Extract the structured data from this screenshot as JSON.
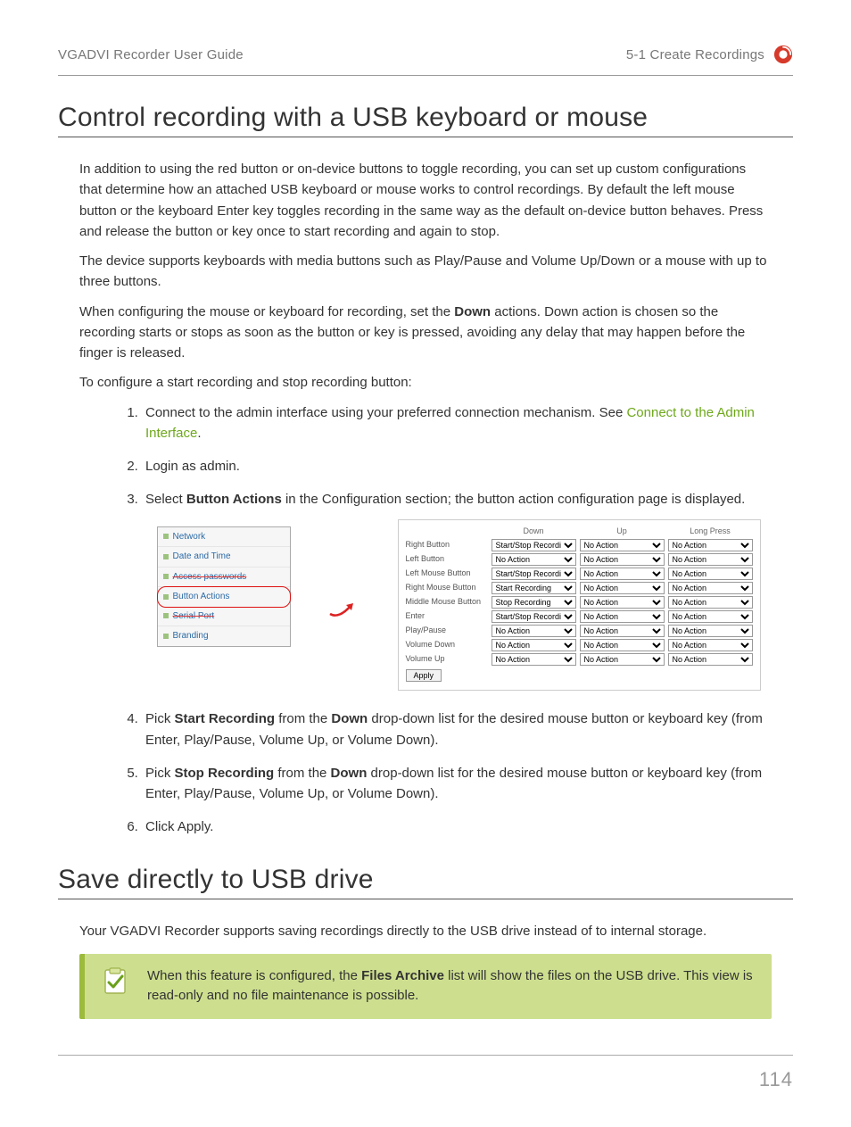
{
  "header": {
    "left": "VGADVI Recorder User Guide",
    "right": "5-1 Create Recordings"
  },
  "section1": {
    "title": "Control recording with a USB keyboard or mouse",
    "p1": "In addition to using the red button or on-device buttons to toggle recording, you can set up custom configurations that determine how an attached USB keyboard or mouse works to control recordings. By default the left mouse button or the keyboard Enter key toggles recording in the same way as the default on-device button behaves. Press and release the button or key once to start recording and again to stop.",
    "p2": "The device supports keyboards with media buttons such as Play/Pause and Volume Up/Down or a mouse with up to three buttons.",
    "p3a": "When configuring the mouse or keyboard for recording, set the ",
    "p3b": "Down",
    "p3c": " actions. Down action is chosen so the recording starts or stops as soon as the button or key is pressed, avoiding any delay that may happen before the finger is released.",
    "p4": "To configure a start recording and stop recording button:",
    "steps": {
      "s1a": "Connect to the admin interface using your preferred connection mechanism. See ",
      "s1link": "Connect to the Admin Interface",
      "s1b": ".",
      "s2": "Login as admin.",
      "s3a": "Select ",
      "s3b": "Button Actions",
      "s3c": " in the Configuration section; the button action configuration page is displayed.",
      "s4a": "Pick ",
      "s4b": "Start Recording",
      "s4c": " from the ",
      "s4d": "Down",
      "s4e": " drop-down list for the desired mouse button or keyboard key (from Enter, Play/Pause, Volume Up, or Volume Down).",
      "s5a": "Pick ",
      "s5b": "Stop Recording",
      "s5c": " from the ",
      "s5d": "Down",
      "s5e": " drop-down list for the desired mouse button or keyboard key (from Enter, Play/Pause, Volume Up, or Volume Down).",
      "s6": "Click Apply."
    }
  },
  "uiShot": {
    "side": {
      "r1": "Network",
      "r2": "Date and Time",
      "r3": "Access passwords",
      "r4": "Button Actions",
      "r5": "Serial Port",
      "r6": "Branding"
    },
    "columns": {
      "c1": "Down",
      "c2": "Up",
      "c3": "Long Press"
    },
    "rows": [
      {
        "label": "Right Button",
        "down": "Start/Stop Recording",
        "up": "No Action",
        "long": "No Action"
      },
      {
        "label": "Left Button",
        "down": "No Action",
        "up": "No Action",
        "long": "No Action"
      },
      {
        "label": "Left Mouse Button",
        "down": "Start/Stop Recording",
        "up": "No Action",
        "long": "No Action"
      },
      {
        "label": "Right Mouse Button",
        "down": "Start Recording",
        "up": "No Action",
        "long": "No Action"
      },
      {
        "label": "Middle Mouse Button",
        "down": "Stop Recording",
        "up": "No Action",
        "long": "No Action"
      },
      {
        "label": "Enter",
        "down": "Start/Stop Recording",
        "up": "No Action",
        "long": "No Action"
      },
      {
        "label": "Play/Pause",
        "down": "No Action",
        "up": "No Action",
        "long": "No Action"
      },
      {
        "label": "Volume Down",
        "down": "No Action",
        "up": "No Action",
        "long": "No Action"
      },
      {
        "label": "Volume Up",
        "down": "No Action",
        "up": "No Action",
        "long": "No Action"
      }
    ],
    "apply": "Apply"
  },
  "section2": {
    "title": "Save directly to USB drive",
    "p1": "Your VGADVI Recorder supports saving recordings directly to the USB drive instead of to internal storage.",
    "note_a": "When this feature is configured, the ",
    "note_b": "Files Archive",
    "note_c": " list will show the files on the USB drive. This view is read-only and no file maintenance is possible."
  },
  "pageNumber": "114"
}
